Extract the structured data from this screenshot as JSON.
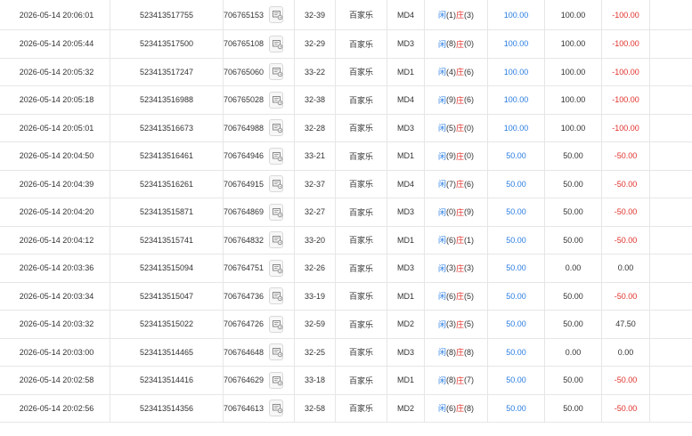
{
  "icons": {
    "replay": "replay-icon"
  },
  "colors": {
    "player": "#2a7de1",
    "banker": "#e0312b",
    "bet": "#2a7de1",
    "negative": "#e0312b",
    "neutral": "#333333"
  },
  "rows": [
    {
      "time": "2026-05-14 20:06:01",
      "order": "523413517755",
      "round": "706765153",
      "shoe": "32-39",
      "game": "百家乐",
      "table": "MD4",
      "p_label": "闲",
      "p": "(1)",
      "b_label": "庄",
      "b": "(3)",
      "bet": "100.00",
      "valid": "100.00",
      "win": "-100.00",
      "win_color": "red"
    },
    {
      "time": "2026-05-14 20:05:44",
      "order": "523413517500",
      "round": "706765108",
      "shoe": "32-29",
      "game": "百家乐",
      "table": "MD3",
      "p_label": "闲",
      "p": "(8)",
      "b_label": "庄",
      "b": "(0)",
      "bet": "100.00",
      "valid": "100.00",
      "win": "-100.00",
      "win_color": "red"
    },
    {
      "time": "2026-05-14 20:05:32",
      "order": "523413517247",
      "round": "706765060",
      "shoe": "33-22",
      "game": "百家乐",
      "table": "MD1",
      "p_label": "闲",
      "p": "(4)",
      "b_label": "庄",
      "b": "(6)",
      "bet": "100.00",
      "valid": "100.00",
      "win": "-100.00",
      "win_color": "red"
    },
    {
      "time": "2026-05-14 20:05:18",
      "order": "523413516988",
      "round": "706765028",
      "shoe": "32-38",
      "game": "百家乐",
      "table": "MD4",
      "p_label": "闲",
      "p": "(9)",
      "b_label": "庄",
      "b": "(6)",
      "bet": "100.00",
      "valid": "100.00",
      "win": "-100.00",
      "win_color": "red"
    },
    {
      "time": "2026-05-14 20:05:01",
      "order": "523413516673",
      "round": "706764988",
      "shoe": "32-28",
      "game": "百家乐",
      "table": "MD3",
      "p_label": "闲",
      "p": "(5)",
      "b_label": "庄",
      "b": "(0)",
      "bet": "100.00",
      "valid": "100.00",
      "win": "-100.00",
      "win_color": "red"
    },
    {
      "time": "2026-05-14 20:04:50",
      "order": "523413516461",
      "round": "706764946",
      "shoe": "33-21",
      "game": "百家乐",
      "table": "MD1",
      "p_label": "闲",
      "p": "(9)",
      "b_label": "庄",
      "b": "(0)",
      "bet": "50.00",
      "valid": "50.00",
      "win": "-50.00",
      "win_color": "red"
    },
    {
      "time": "2026-05-14 20:04:39",
      "order": "523413516261",
      "round": "706764915",
      "shoe": "32-37",
      "game": "百家乐",
      "table": "MD4",
      "p_label": "闲",
      "p": "(7)",
      "b_label": "庄",
      "b": "(6)",
      "bet": "50.00",
      "valid": "50.00",
      "win": "-50.00",
      "win_color": "red"
    },
    {
      "time": "2026-05-14 20:04:20",
      "order": "523413515871",
      "round": "706764869",
      "shoe": "32-27",
      "game": "百家乐",
      "table": "MD3",
      "p_label": "闲",
      "p": "(0)",
      "b_label": "庄",
      "b": "(9)",
      "bet": "50.00",
      "valid": "50.00",
      "win": "-50.00",
      "win_color": "red"
    },
    {
      "time": "2026-05-14 20:04:12",
      "order": "523413515741",
      "round": "706764832",
      "shoe": "33-20",
      "game": "百家乐",
      "table": "MD1",
      "p_label": "闲",
      "p": "(6)",
      "b_label": "庄",
      "b": "(1)",
      "bet": "50.00",
      "valid": "50.00",
      "win": "-50.00",
      "win_color": "red"
    },
    {
      "time": "2026-05-14 20:03:36",
      "order": "523413515094",
      "round": "706764751",
      "shoe": "32-26",
      "game": "百家乐",
      "table": "MD3",
      "p_label": "闲",
      "p": "(3)",
      "b_label": "庄",
      "b": "(3)",
      "bet": "50.00",
      "valid": "0.00",
      "win": "0.00",
      "win_color": "dark"
    },
    {
      "time": "2026-05-14 20:03:34",
      "order": "523413515047",
      "round": "706764736",
      "shoe": "33-19",
      "game": "百家乐",
      "table": "MD1",
      "p_label": "闲",
      "p": "(6)",
      "b_label": "庄",
      "b": "(5)",
      "bet": "50.00",
      "valid": "50.00",
      "win": "-50.00",
      "win_color": "red"
    },
    {
      "time": "2026-05-14 20:03:32",
      "order": "523413515022",
      "round": "706764726",
      "shoe": "32-59",
      "game": "百家乐",
      "table": "MD2",
      "p_label": "闲",
      "p": "(3)",
      "b_label": "庄",
      "b": "(5)",
      "bet": "50.00",
      "valid": "50.00",
      "win": "47.50",
      "win_color": "dark"
    },
    {
      "time": "2026-05-14 20:03:00",
      "order": "523413514465",
      "round": "706764648",
      "shoe": "32-25",
      "game": "百家乐",
      "table": "MD3",
      "p_label": "闲",
      "p": "(8)",
      "b_label": "庄",
      "b": "(8)",
      "bet": "50.00",
      "valid": "0.00",
      "win": "0.00",
      "win_color": "dark"
    },
    {
      "time": "2026-05-14 20:02:58",
      "order": "523413514416",
      "round": "706764629",
      "shoe": "33-18",
      "game": "百家乐",
      "table": "MD1",
      "p_label": "闲",
      "p": "(8)",
      "b_label": "庄",
      "b": "(7)",
      "bet": "50.00",
      "valid": "50.00",
      "win": "-50.00",
      "win_color": "red"
    },
    {
      "time": "2026-05-14 20:02:56",
      "order": "523413514356",
      "round": "706764613",
      "shoe": "32-58",
      "game": "百家乐",
      "table": "MD2",
      "p_label": "闲",
      "p": "(6)",
      "b_label": "庄",
      "b": "(8)",
      "bet": "50.00",
      "valid": "50.00",
      "win": "-50.00",
      "win_color": "red"
    }
  ]
}
